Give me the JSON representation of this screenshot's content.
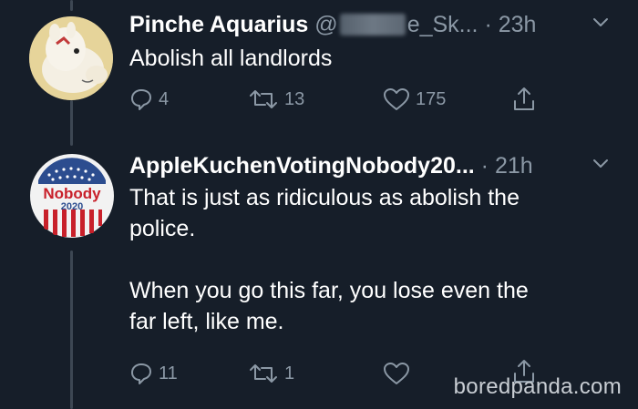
{
  "tweets": [
    {
      "display_name": "Pinche Aquarius",
      "handle_prefix": "@",
      "handle_suffix": "e_Sk...",
      "time": "· 23h",
      "text_lines": [
        "Abolish all landlords"
      ],
      "reply_count": "4",
      "retweet_count": "13",
      "like_count": "175",
      "avatar_icon": "moomin-avatar"
    },
    {
      "display_name": "AppleKuchenVotingNobody20...",
      "time": "· 21h",
      "text_lines": [
        "That is just as ridiculous as abolish the",
        "police.",
        "",
        "When you go this far, you lose even the",
        "far left, like me."
      ],
      "reply_count": "11",
      "retweet_count": "1",
      "like_count": "",
      "badge_text": "Nobody",
      "badge_year": "2020",
      "avatar_icon": "nobody-2020-badge-avatar"
    }
  ],
  "watermark": "boredpanda.com",
  "colors": {
    "background": "#161e29",
    "secondary_text": "#8b98a5",
    "thread_line": "#3d4753"
  }
}
